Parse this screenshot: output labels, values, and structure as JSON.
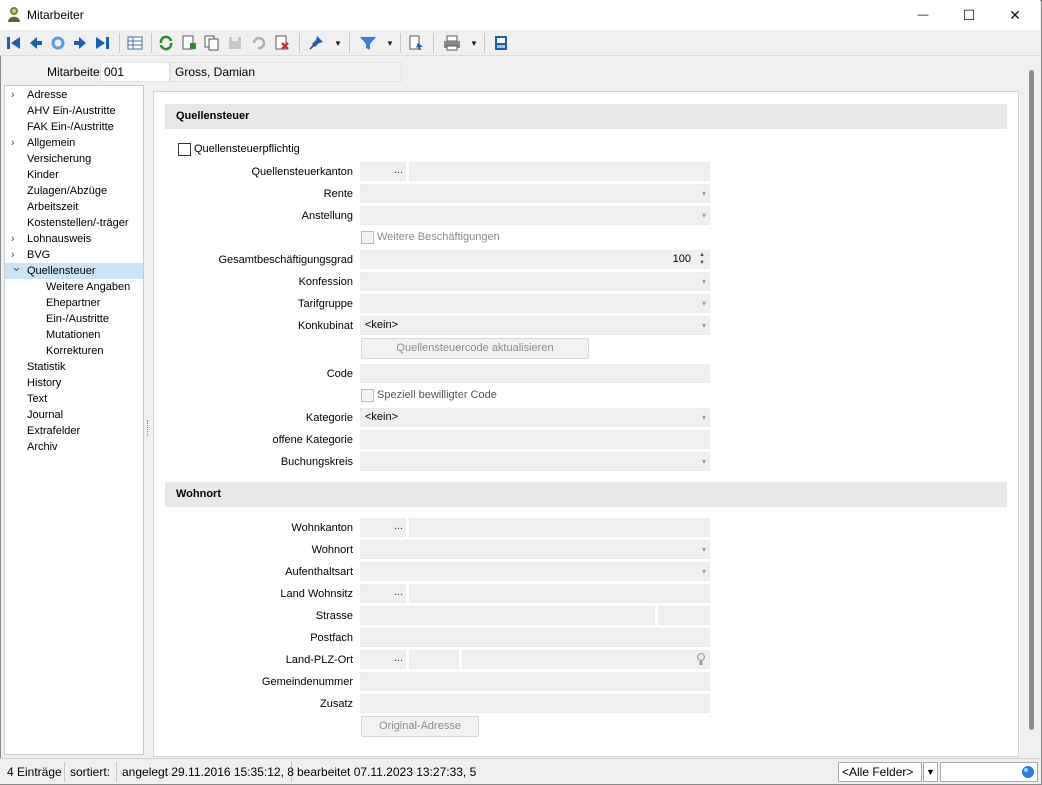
{
  "window": {
    "title": "Mitarbeiter",
    "minimize": "—",
    "maximize": "☐",
    "close": "✕"
  },
  "toolbar": {
    "icons": [
      "first-record",
      "previous-record",
      "refresh-record",
      "next-record",
      "last-record",
      "table-view",
      "reload",
      "new-record",
      "copy-record",
      "save-record",
      "undo",
      "delete-record",
      "pin",
      "filter",
      "report",
      "print",
      "mask-settings"
    ]
  },
  "header": {
    "label": "Mitarbeiter",
    "number": "001",
    "name": "Gross, Damian"
  },
  "nav": {
    "items": [
      {
        "label": "Adresse",
        "expandable": true,
        "level": 0
      },
      {
        "label": "AHV Ein-/Austritte",
        "expandable": false,
        "level": 0
      },
      {
        "label": "FAK Ein-/Austritte",
        "expandable": false,
        "level": 0
      },
      {
        "label": "Allgemein",
        "expandable": true,
        "level": 0
      },
      {
        "label": "Versicherung",
        "expandable": false,
        "level": 0
      },
      {
        "label": "Kinder",
        "expandable": false,
        "level": 0
      },
      {
        "label": "Zulagen/Abzüge",
        "expandable": false,
        "level": 0
      },
      {
        "label": "Arbeitszeit",
        "expandable": false,
        "level": 0
      },
      {
        "label": "Kostenstellen/-träger",
        "expandable": false,
        "level": 0
      },
      {
        "label": "Lohnausweis",
        "expandable": true,
        "level": 0
      },
      {
        "label": "BVG",
        "expandable": true,
        "level": 0
      },
      {
        "label": "Quellensteuer",
        "expandable": true,
        "expanded": true,
        "selected": true,
        "level": 0
      },
      {
        "label": "Weitere Angaben",
        "expandable": false,
        "level": 1
      },
      {
        "label": "Ehepartner",
        "expandable": false,
        "level": 1
      },
      {
        "label": "Ein-/Austritte",
        "expandable": false,
        "level": 1
      },
      {
        "label": "Mutationen",
        "expandable": false,
        "level": 1
      },
      {
        "label": "Korrekturen",
        "expandable": false,
        "level": 1
      },
      {
        "label": "Statistik",
        "expandable": false,
        "level": 0
      },
      {
        "label": "History",
        "expandable": false,
        "level": 0
      },
      {
        "label": "Text",
        "expandable": false,
        "level": 0
      },
      {
        "label": "Journal",
        "expandable": false,
        "level": 0
      },
      {
        "label": "Extrafelder",
        "expandable": false,
        "level": 0
      },
      {
        "label": "Archiv",
        "expandable": false,
        "level": 0
      }
    ]
  },
  "quellensteuer": {
    "section_title": "Quellensteuer",
    "checkbox_label": "Quellensteuerpflichtig",
    "kanton_label": "Quellensteuerkanton",
    "rente_label": "Rente",
    "anstellung_label": "Anstellung",
    "weitere_label": "Weitere Beschäftigungen",
    "grad_label": "Gesamtbeschäftigungsgrad",
    "grad_value": "100",
    "konfession_label": "Konfession",
    "tarif_label": "Tarifgruppe",
    "konkubinat_label": "Konkubinat",
    "konkubinat_value": "<kein>",
    "update_button": "Quellensteuercode aktualisieren",
    "code_label": "Code",
    "speziell_label": "Speziell bewilligter Code",
    "kategorie_label": "Kategorie",
    "kategorie_value": "<kein>",
    "offene_label": "offene Kategorie",
    "buchung_label": "Buchungskreis"
  },
  "wohnort": {
    "section_title": "Wohnort",
    "kanton_label": "Wohnkanton",
    "wohnort_label": "Wohnort",
    "aufenthalt_label": "Aufenthaltsart",
    "land_label": "Land Wohnsitz",
    "strasse_label": "Strasse",
    "postfach_label": "Postfach",
    "plz_label": "Land-PLZ-Ort",
    "gemeinde_label": "Gemeindenummer",
    "zusatz_label": "Zusatz",
    "original_button": "Original-Adresse"
  },
  "common": {
    "dots": "...",
    "dd_arrow": "▾",
    "spin_up": "▲",
    "spin_down": "▼"
  },
  "status": {
    "count": "4 Einträge",
    "sorted": "sortiert:",
    "created": "angelegt 29.11.2016 15:35:12,  8",
    "edited": "bearbeitet 07.11.2023 13:27:33,  5",
    "field_filter": "<Alle Felder>"
  },
  "colors": {
    "accent": "#1a5fb4",
    "selection": "#cce4f7",
    "section": "#e8e8e8"
  }
}
